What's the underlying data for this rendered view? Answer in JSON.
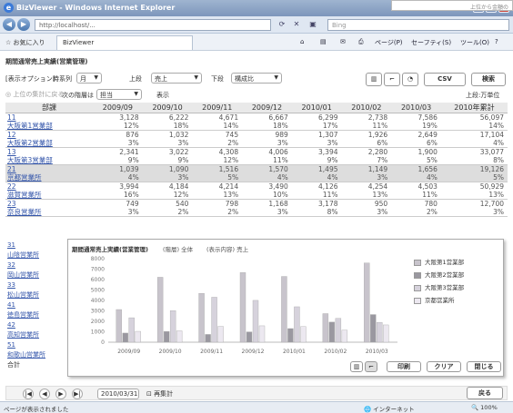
{
  "window": {
    "title": "BizViewer - Windows Internet Explorer",
    "snip_text": "上位から金額の"
  },
  "browser": {
    "address": "http://localhost/...",
    "search_placeholder": "Bing",
    "favorites_label": "お気に入り",
    "tab_title": "BizViewer",
    "cmd_page": "ページ(P)",
    "cmd_safety": "セーフティ(S)",
    "cmd_tools": "ツール(O)"
  },
  "page": {
    "title": "期間通常売上実績(営業管理)"
  },
  "options": {
    "label": "[表示オプション]",
    "period_label": "時系列",
    "period_value": "月",
    "upper_label": "上段",
    "upper_value": "売上",
    "lower_label": "下段",
    "lower_value": "構成比",
    "csv": "CSV",
    "search": "検索"
  },
  "row2": {
    "toggle": "上位の集計に戻る",
    "next_label": "次の階層は",
    "next_value": "担当",
    "display_label": "表示",
    "unit": "上段:万単位"
  },
  "table": {
    "headers": [
      "部課",
      "2009/09",
      "2009/10",
      "2009/11",
      "2009/12",
      "2010/01",
      "2010/02",
      "2010/03",
      "2010年累計"
    ],
    "rows": [
      {
        "code": "11",
        "name": "大阪第1営業部",
        "upper": [
          "3,128",
          "6,222",
          "4,671",
          "6,667",
          "6,299",
          "2,738",
          "7,586",
          "56,097"
        ],
        "lower": [
          "12%",
          "18%",
          "14%",
          "18%",
          "17%",
          "11%",
          "19%",
          "14%"
        ]
      },
      {
        "code": "12",
        "name": "大阪第2営業部",
        "upper": [
          "876",
          "1,032",
          "745",
          "989",
          "1,307",
          "1,926",
          "2,649",
          "17,104"
        ],
        "lower": [
          "3%",
          "3%",
          "2%",
          "3%",
          "3%",
          "6%",
          "6%",
          "4%"
        ]
      },
      {
        "code": "13",
        "name": "大阪第3営業部",
        "upper": [
          "2,341",
          "3,022",
          "4,308",
          "4,006",
          "3,394",
          "2,280",
          "1,900",
          "33,077"
        ],
        "lower": [
          "9%",
          "9%",
          "12%",
          "11%",
          "9%",
          "7%",
          "5%",
          "8%"
        ]
      },
      {
        "code": "21",
        "name": "京都営業所",
        "upper": [
          "1,039",
          "1,090",
          "1,516",
          "1,570",
          "1,495",
          "1,149",
          "1,656",
          "19,126"
        ],
        "lower": [
          "4%",
          "3%",
          "5%",
          "4%",
          "4%",
          "3%",
          "4%",
          "5%"
        ]
      },
      {
        "code": "22",
        "name": "滋賀営業所",
        "upper": [
          "3,994",
          "4,184",
          "4,214",
          "3,490",
          "4,126",
          "4,254",
          "4,503",
          "50,929"
        ],
        "lower": [
          "16%",
          "12%",
          "13%",
          "10%",
          "11%",
          "13%",
          "11%",
          "13%"
        ]
      },
      {
        "code": "23",
        "name": "奈良営業所",
        "upper": [
          "749",
          "540",
          "798",
          "1,168",
          "3,178",
          "950",
          "780",
          "12,700"
        ],
        "lower": [
          "3%",
          "2%",
          "2%",
          "3%",
          "8%",
          "3%",
          "2%",
          "3%"
        ]
      }
    ]
  },
  "sidebar_rows": [
    {
      "code": "31",
      "name": "山陰営業所"
    },
    {
      "code": "32",
      "name": "岡山営業所"
    },
    {
      "code": "33",
      "name": "松山営業所"
    },
    {
      "code": "41",
      "name": "徳島営業所"
    },
    {
      "code": "42",
      "name": "高知営業所"
    },
    {
      "code": "51",
      "name": "和歌山営業所"
    }
  ],
  "sidebar_total": "合計",
  "popup": {
    "title": "期間通常売上実績(営業管理)",
    "meta1": "(階層) 全体",
    "meta2": "(表示内容) 売上",
    "print": "印刷",
    "clear": "クリア",
    "close": "閉じる"
  },
  "chart_data": {
    "type": "bar",
    "categories": [
      "2009/09",
      "2009/10",
      "2009/11",
      "2009/12",
      "2010/01",
      "2010/02",
      "2010/03"
    ],
    "ylim": [
      0,
      8000
    ],
    "yticks": [
      "8000",
      "7000",
      "6000",
      "5000",
      "4000",
      "3000",
      "2000",
      "1000",
      "0"
    ],
    "series": [
      {
        "name": "大阪第1営業部",
        "color": "#c8c4cc",
        "values": [
          3128,
          6222,
          4671,
          6667,
          6299,
          2738,
          7586
        ]
      },
      {
        "name": "大阪第2営業部",
        "color": "#9a98a0",
        "values": [
          876,
          1032,
          745,
          989,
          1307,
          1926,
          2649
        ]
      },
      {
        "name": "大阪第3営業部",
        "color": "#d6d2dc",
        "values": [
          2341,
          3022,
          4308,
          4006,
          3394,
          2280,
          1900
        ]
      },
      {
        "name": "京都営業所",
        "color": "#ece8f0",
        "values": [
          1039,
          1090,
          1516,
          1570,
          1495,
          1149,
          1656
        ]
      }
    ]
  },
  "footer": {
    "date": "2010/03/31",
    "recalc": "再集計",
    "back": "戻る"
  },
  "status": {
    "left": "ページが表示されました",
    "zone": "インターネット",
    "zoom": "100%"
  }
}
